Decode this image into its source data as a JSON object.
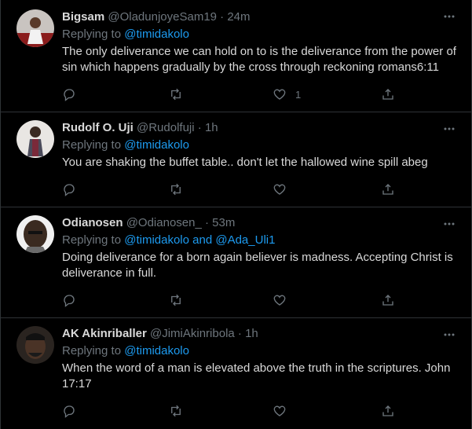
{
  "tweets": [
    {
      "name": "Bigsam",
      "handle": "@OladunjoyeSam19",
      "sep": "·",
      "time": "24m",
      "replying_prefix": "Replying to ",
      "mentions": [
        "@timidakolo"
      ],
      "mention_joiner": "",
      "text": "The only deliverance we can hold on to is the deliverance from the power of sin which happens gradually by the cross through reckoning romans6:11",
      "like_count": "1"
    },
    {
      "name": "Rudolf O. Uji",
      "handle": "@Rudolfuji",
      "sep": "·",
      "time": "1h",
      "replying_prefix": "Replying to ",
      "mentions": [
        "@timidakolo"
      ],
      "mention_joiner": "",
      "text": "You are shaking the buffet table.. don't let the hallowed wine spill abeg",
      "like_count": ""
    },
    {
      "name": "Odianosen",
      "handle": "@Odianosen_",
      "sep": "·",
      "time": "53m",
      "replying_prefix": "Replying to ",
      "mentions": [
        "@timidakolo",
        "@Ada_Uli1"
      ],
      "mention_joiner": " and ",
      "text": "Doing deliverance for a born again believer is madness. Accepting Christ is deliverance in full.",
      "like_count": ""
    },
    {
      "name": "AK Akinriballer",
      "handle": "@JimiAkinribola",
      "sep": "·",
      "time": "1h",
      "replying_prefix": "Replying to ",
      "mentions": [
        "@timidakolo"
      ],
      "mention_joiner": "",
      "text": "When the word of a man is elevated above the truth in the scriptures. John 17:17",
      "like_count": ""
    }
  ],
  "icons": {
    "reply": "reply-icon",
    "retweet": "retweet-icon",
    "like": "like-icon",
    "share": "share-icon",
    "more": "more-icon"
  },
  "colors": {
    "background": "#000000",
    "text": "#d9d9d9",
    "muted": "#6e767d",
    "link": "#1d9bf0",
    "border": "#2f3336"
  }
}
